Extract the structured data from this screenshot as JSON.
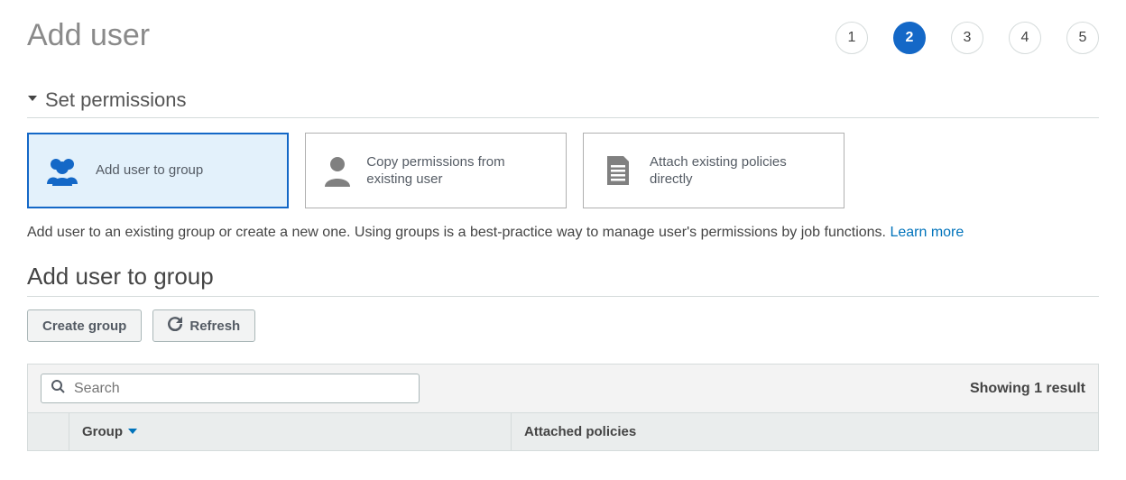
{
  "page": {
    "title": "Add user"
  },
  "steps": {
    "items": [
      "1",
      "2",
      "3",
      "4",
      "5"
    ],
    "active_index": 1
  },
  "permissions_section": {
    "heading": "Set permissions",
    "options": [
      {
        "label": "Add user to group",
        "icon": "group-icon",
        "selected": true
      },
      {
        "label": "Copy permissions from existing user",
        "icon": "user-icon",
        "selected": false
      },
      {
        "label": "Attach existing policies directly",
        "icon": "document-icon",
        "selected": false
      }
    ],
    "description_text": "Add user to an existing group or create a new one. Using groups is a best-practice way to manage user's permissions by job functions. ",
    "learn_more": "Learn more"
  },
  "group_section": {
    "heading": "Add user to group",
    "create_button": "Create group",
    "refresh_button": "Refresh",
    "search_placeholder": "Search",
    "result_count_text": "Showing 1 result",
    "columns": {
      "group": "Group",
      "attached_policies": "Attached policies"
    }
  }
}
